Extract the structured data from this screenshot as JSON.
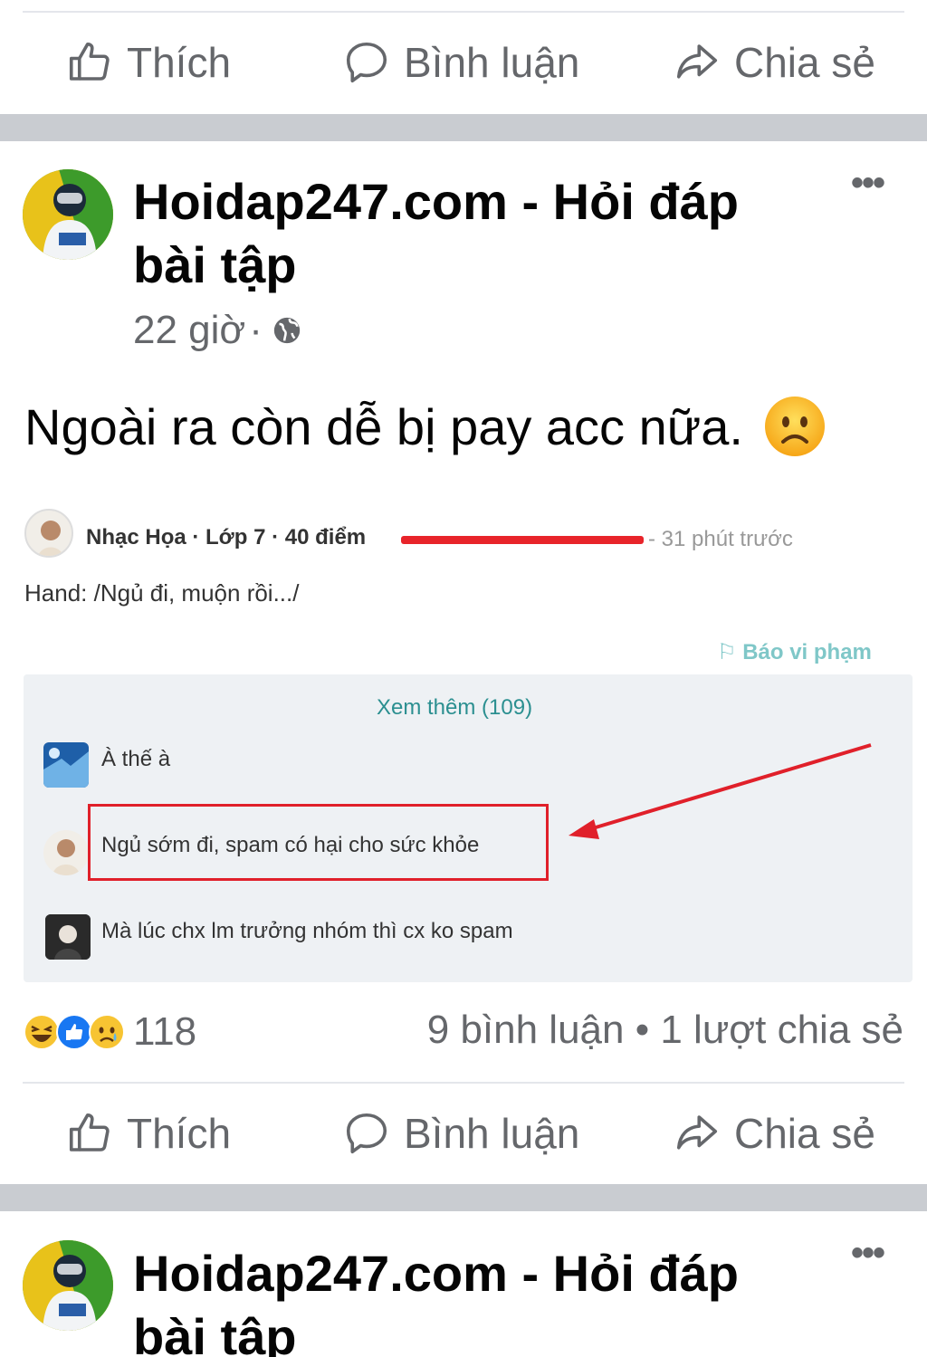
{
  "actions": {
    "like": "Thích",
    "comment": "Bình luận",
    "share": "Chia sẻ"
  },
  "post1": {
    "page_name": "Hoidap247.com - Hỏi đáp bài tập",
    "time": "22 giờ",
    "separator": "·",
    "text": "Ngoài ra còn dễ bị pay acc nữa.",
    "embed": {
      "user_line": "Nhạc Họa · Lớp 7 · 40 điểm",
      "time": "- 31 phút trước",
      "content": "Hand: /Ngủ đi, muộn rồi.../",
      "report": "Báo vi phạm",
      "see_more": "Xem thêm (109)",
      "comments": [
        "À thế à",
        "Ngủ sớm đi, spam có hại cho sức khỏe",
        "Mà lúc chx lm trưởng nhóm thì cx ko spam"
      ]
    },
    "reaction_count": "118",
    "stats": "9 bình luận • 1 lượt chia sẻ"
  },
  "post2": {
    "page_name": "Hoidap247.com - Hỏi đáp bài tập"
  },
  "colors": {
    "secondary_text": "#65676b",
    "feed_gap": "#c9ccd1",
    "highlight_red": "#e0202a",
    "teal_link": "#2b8f90"
  }
}
